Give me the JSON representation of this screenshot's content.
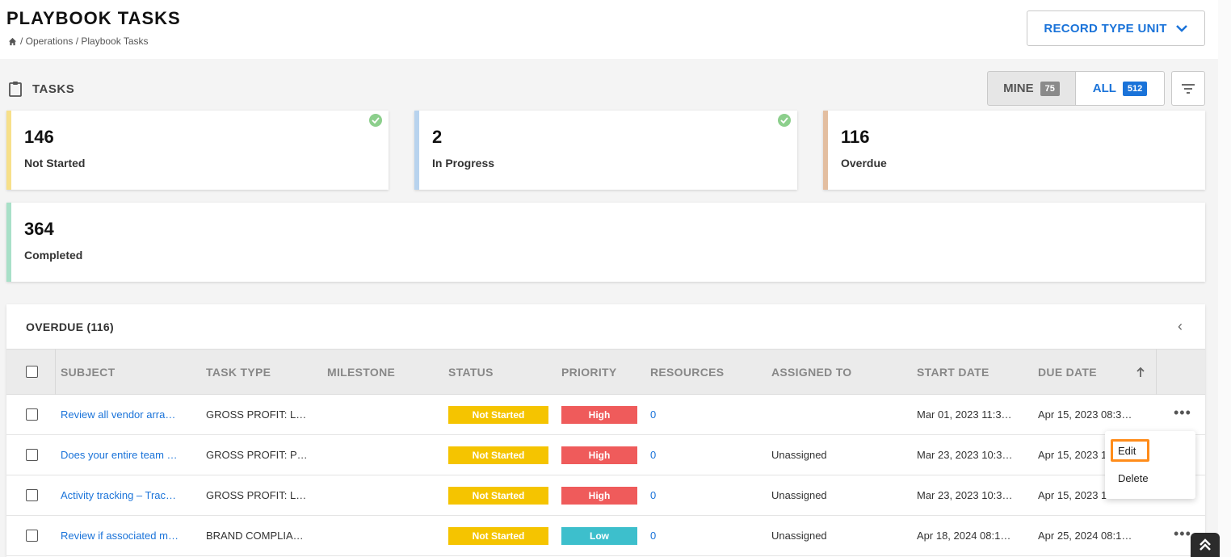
{
  "header": {
    "title": "PLAYBOOK TASKS",
    "breadcrumb": " / Operations / Playbook Tasks",
    "record_type_label": "RECORD TYPE UNIT"
  },
  "tasks": {
    "label": "TASKS",
    "mine_label": "MINE",
    "mine_count": "75",
    "all_label": "ALL",
    "all_count": "512"
  },
  "cards": [
    {
      "value": "146",
      "label": "Not Started",
      "color": "#f7e08a"
    },
    {
      "value": "2",
      "label": "In Progress",
      "color": "#b8d3ee"
    },
    {
      "value": "116",
      "label": "Overdue",
      "color": "#e3bea0"
    },
    {
      "value": "364",
      "label": "Completed",
      "color": "#a8e0c8"
    }
  ],
  "section": {
    "title": "OVERDUE (116)",
    "columns": [
      "SUBJECT",
      "TASK TYPE",
      "MILESTONE",
      "STATUS",
      "PRIORITY",
      "RESOURCES",
      "ASSIGNED TO",
      "START DATE",
      "DUE DATE"
    ]
  },
  "rows": [
    {
      "subject": "Review all vendor arra…",
      "task_type": "GROSS PROFIT: L…",
      "milestone": "",
      "status": "Not Started",
      "priority": "High",
      "resources": "0",
      "assigned": "",
      "start": "Mar 01, 2023 11:3…",
      "due": "Apr 15, 2023 08:3…"
    },
    {
      "subject": "Does your entire team …",
      "task_type": "GROSS PROFIT: P…",
      "milestone": "",
      "status": "Not Started",
      "priority": "High",
      "resources": "0",
      "assigned": "Unassigned",
      "start": "Mar 23, 2023 10:3…",
      "due": "Apr 15, 2023 1…"
    },
    {
      "subject": "Activity tracking – Trac…",
      "task_type": "GROSS PROFIT: L…",
      "milestone": "",
      "status": "Not Started",
      "priority": "High",
      "resources": "0",
      "assigned": "Unassigned",
      "start": "Mar 23, 2023 10:3…",
      "due": "Apr 15, 2023 12…"
    },
    {
      "subject": "Review if associated m…",
      "task_type": "BRAND COMPLIA…",
      "milestone": "",
      "status": "Not Started",
      "priority": "Low",
      "resources": "0",
      "assigned": "Unassigned",
      "start": "Apr 18, 2024 08:1…",
      "due": "Apr 25, 2024 08:1…"
    }
  ],
  "colors": {
    "status_not_started": "#f5c400",
    "priority_high": "#ef5b5b",
    "priority_low": "#3dbfcc",
    "accent": "#1a73d9",
    "menu_highlight": "#ff8c1a"
  },
  "context_menu": {
    "edit_label": "Edit",
    "delete_label": "Delete"
  },
  "icons": {
    "home": "home-icon",
    "chevron": "chevron-down-icon",
    "clipboard": "clipboard-icon",
    "filter": "filter-icon",
    "check": "check-circle-icon",
    "collapse": "chevron-left-icon",
    "sort": "arrow-up-icon",
    "more": "more-horizontal-icon",
    "scroll_top": "double-chevron-up-icon"
  }
}
